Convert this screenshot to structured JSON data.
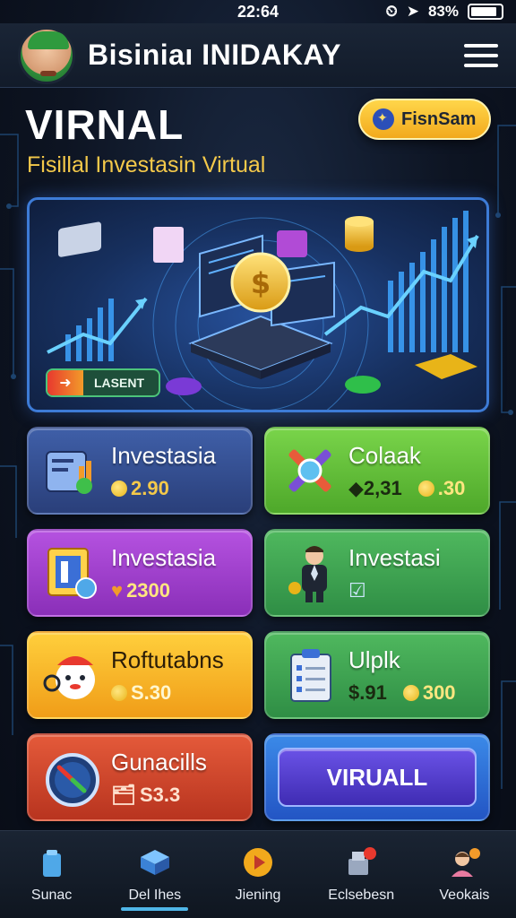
{
  "status_bar": {
    "time": "22:64",
    "battery": "83%"
  },
  "header": {
    "title": "Bisiniaı INIDAKAY",
    "avatar": "avatar",
    "menu_icon": "hamburger-menu-icon"
  },
  "hero": {
    "title": "VIRNAL",
    "subtitle": "Fisillal Investasin Virtual",
    "button_label": "FisnSam",
    "button_icon": "star-badge-icon"
  },
  "banner": {
    "button_label": "LASENT",
    "button_icon": "arrow-right-icon",
    "illustration": "investment-dashboard-illustration"
  },
  "cards": [
    {
      "title": "Investasia",
      "values": [
        "2.90"
      ],
      "icon": "portfolio-chart-icon",
      "color": "#3f5fa8"
    },
    {
      "title": "Colaak",
      "values": [
        "◆2,31",
        ".30"
      ],
      "icon": "tools-gear-icon",
      "color": "#79d44a"
    },
    {
      "title": "Investasia",
      "values": [
        "2300"
      ],
      "icon": "frame-card-icon",
      "color": "#b552e0"
    },
    {
      "title": "Investasi",
      "values": [
        ""
      ],
      "icon": "businessman-icon",
      "color": "#4fb85e"
    },
    {
      "title": "Roftutabns",
      "values": [
        "S.30"
      ],
      "icon": "mascot-icon",
      "color": "#ffcf3c"
    },
    {
      "title": "Ulplk",
      "values": [
        "$.91",
        "300"
      ],
      "icon": "clipboard-icon",
      "color": "#4fb85e"
    },
    {
      "title": "Gunacills",
      "values": [
        "S3.3"
      ],
      "icon": "speedometer-icon",
      "color": "#e45a3a"
    },
    {
      "title": "VIRUALL",
      "icon": "",
      "color": "#3b8ae8"
    }
  ],
  "nav": [
    {
      "label": "Sunac",
      "icon": "home-phone-icon"
    },
    {
      "label": "Del Ihes",
      "icon": "cube-icon"
    },
    {
      "label": "Jiening",
      "icon": "play-icon"
    },
    {
      "label": "Eclsebesn",
      "icon": "gift-notification-icon"
    },
    {
      "label": "Veokais",
      "icon": "profile-icon"
    }
  ]
}
